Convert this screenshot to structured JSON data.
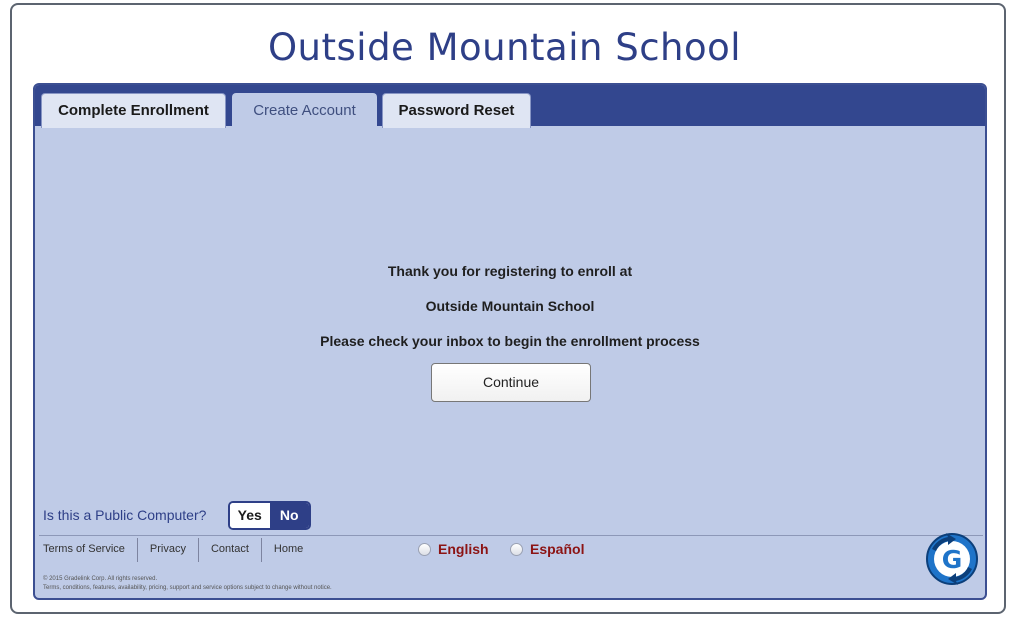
{
  "header": {
    "title": "Outside Mountain School"
  },
  "tabs": [
    {
      "label": "Complete Enrollment",
      "active": false
    },
    {
      "label": "Create Account",
      "active": true
    },
    {
      "label": "Password Reset",
      "active": false
    }
  ],
  "message": {
    "line1": "Thank you for registering to enroll at",
    "line2": "Outside Mountain School",
    "line3": "Please check your inbox to begin the enrollment process"
  },
  "continue_label": "Continue",
  "public_computer": {
    "question": "Is this a Public Computer?",
    "yes_label": "Yes",
    "no_label": "No",
    "selected": "No"
  },
  "footer": {
    "links": [
      "Terms of Service",
      "Privacy",
      "Contact",
      "Home"
    ],
    "languages": [
      {
        "label": "English",
        "selected": false
      },
      {
        "label": "Español",
        "selected": false
      }
    ],
    "copyright": "© 2015 Gradelink Corp. All rights reserved.",
    "disclaimer": "Terms, conditions, features, availability, pricing, support and service options subject to change without notice.",
    "logo_letter": "G"
  },
  "colors": {
    "brand_navy": "#2e3f87",
    "panel_bg": "#bfcbe7",
    "language_red": "#8c1414",
    "logo_blue": "#1f74c9"
  }
}
